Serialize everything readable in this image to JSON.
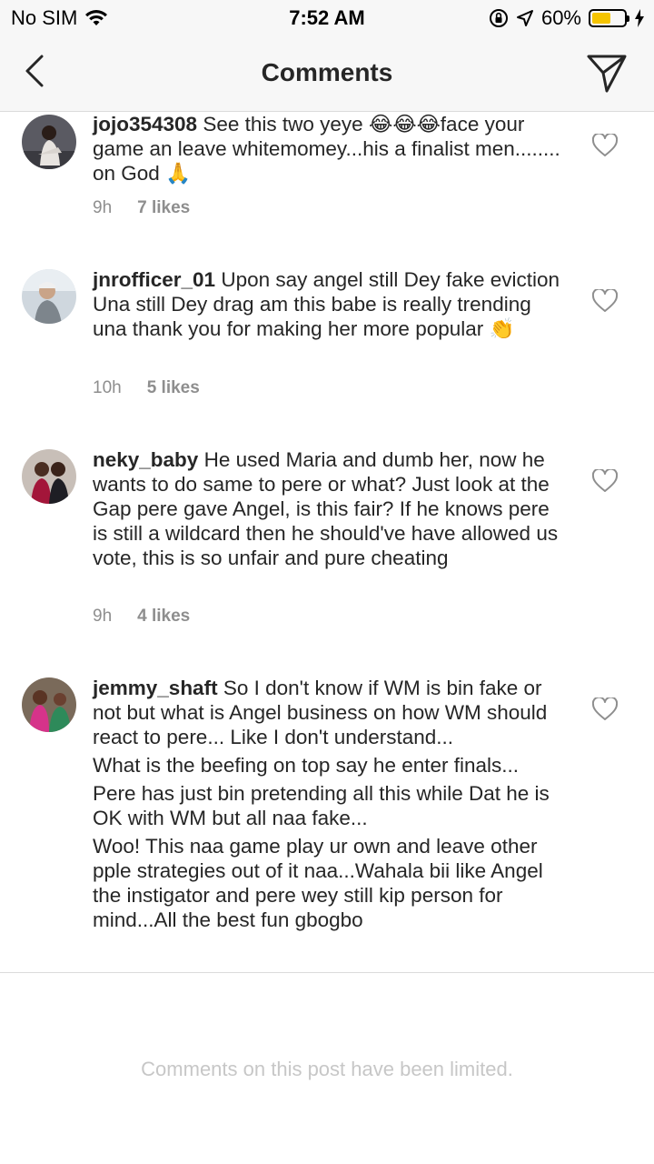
{
  "status_bar": {
    "carrier": "No SIM",
    "time": "7:52 AM",
    "battery": "60%",
    "battery_level": 0.6
  },
  "header": {
    "title": "Comments"
  },
  "comments": [
    {
      "username": "jojo354308",
      "text": [
        "See this two yeye 😂😂😂face your game an leave whitemomey...his a finalist men........ on God 🙏"
      ],
      "time": "9h",
      "likes": "7 likes"
    },
    {
      "username": "jnrofficer_01",
      "text": [
        "Upon say angel still Dey fake eviction Una still Dey drag am  this babe is really trending una thank you for making her more popular 👏"
      ],
      "time": "10h",
      "likes": "5 likes"
    },
    {
      "username": "neky_baby",
      "text": [
        "He used Maria and dumb her, now he wants to do same to pere or what? Just look at the Gap pere gave Angel, is this fair? If he knows pere is still a wildcard then he should've have allowed us vote, this is so unfair and pure cheating"
      ],
      "time": "9h",
      "likes": "4 likes"
    },
    {
      "username": "jemmy_shaft",
      "text": [
        "So I don't know if WM is bin fake or not but what is Angel business on how WM should react to pere... Like I don't understand...",
        "What is the beefing on top say he enter finals...",
        "Pere has just bin pretending all this while Dat he is OK with WM but all naa fake...",
        "Woo! This naa game play ur own and leave other pple strategies out of it naa...Wahala bii like Angel the instigator and pere wey still kip person for mind...All the best fun gbogbo"
      ],
      "time": "",
      "likes": ""
    }
  ],
  "footer": {
    "limited_text": "Comments on this post have been limited."
  }
}
